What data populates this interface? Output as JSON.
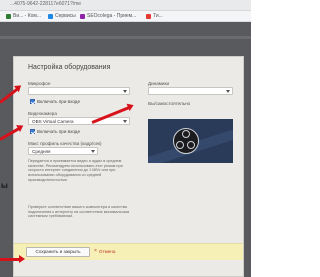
{
  "browser": {
    "url": "...4075-9642-228117e6071?/me",
    "bookmarks": [
      {
        "label": "Ви... - Ком...",
        "color": "#2e7d32"
      },
      {
        "label": "Сервисы",
        "color": "#1e88e5"
      },
      {
        "label": "SEOcolega - Прием...",
        "color": "#8e24aa"
      },
      {
        "label": "Ти...",
        "color": "#e53935"
      }
    ]
  },
  "dialog": {
    "title": "Настройка оборудования",
    "microphone": {
      "label": "Микрофон",
      "value": ""
    },
    "mic_autoenable": "Включать при входе",
    "webcam": {
      "label": "Видеокамера",
      "value": "OBS Virtual Camera"
    },
    "cam_autoenable": "Включать при входе",
    "quality": {
      "label": "Макс профиль качества (кадр/сек)",
      "value": "Средняя"
    },
    "quality_desc": "Передается и принимается видео и аудио в среднем качестве. Рекомендуем использовать этот режим при скорости интернет соединения до 1 Мб/с или при использовании оборудования со средней производительностью.",
    "warning_desc": "Проверьте соответствие вашего компьютера и качества подключения к интернету на соответствие минимальным системным требованиям.",
    "speakers": {
      "label": "Динамики",
      "value": ""
    },
    "self_view": "Вы/самостоятельно",
    "save_button": "Сохранить и закрыть",
    "cancel_button": "Отмена"
  },
  "page_edge_text": "ы"
}
